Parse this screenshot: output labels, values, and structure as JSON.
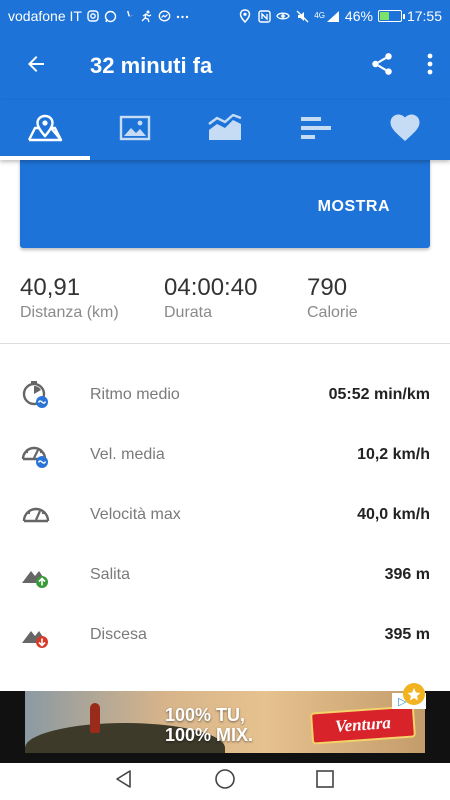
{
  "status_bar": {
    "carrier": "vodafone IT",
    "battery": "46%",
    "battery_level": 0.46,
    "time": "17:55",
    "network": "4G",
    "icons": [
      "instagram-icon",
      "whatsapp-icon",
      "pinwheel-icon",
      "runner-icon",
      "messenger-icon",
      "more-dots-icon",
      "location-icon",
      "nfc-icon",
      "eye-icon",
      "mute-icon",
      "signal-icon",
      "battery-icon"
    ]
  },
  "app_bar": {
    "title": "32 minuti fa",
    "back_icon": "back-arrow-icon",
    "share_icon": "share-icon",
    "menu_icon": "overflow-menu-icon"
  },
  "tabs": [
    {
      "icon": "map-icon",
      "active": true
    },
    {
      "icon": "photo-icon",
      "active": false
    },
    {
      "icon": "chart-icon",
      "active": false
    },
    {
      "icon": "splits-icon",
      "active": false
    },
    {
      "icon": "heart-icon",
      "active": false
    }
  ],
  "card": {
    "button_label": "MOSTRA"
  },
  "summary": [
    {
      "value": "40,91",
      "label": "Distanza (km)"
    },
    {
      "value": "04:00:40",
      "label": "Durata"
    },
    {
      "value": "790",
      "label": "Calorie"
    }
  ],
  "details": [
    {
      "label": "Ritmo medio",
      "value": "05:52 min/km",
      "icon": "pace-icon"
    },
    {
      "label": "Vel. media",
      "value": "10,2 km/h",
      "icon": "avg-speed-icon"
    },
    {
      "label": "Velocità max",
      "value": "40,0 km/h",
      "icon": "max-speed-icon"
    },
    {
      "label": "Salita",
      "value": "396 m",
      "icon": "ascent-icon"
    },
    {
      "label": "Discesa",
      "value": "395 m",
      "icon": "descent-icon"
    }
  ],
  "ad": {
    "text_line1": "100% TU,",
    "text_line2": "100% MIX.",
    "brand": "Ventura"
  },
  "colors": {
    "primary": "#1e73d8",
    "ascent": "#3a9a3a",
    "descent": "#d83a2a",
    "badge": "#2a74d8"
  }
}
